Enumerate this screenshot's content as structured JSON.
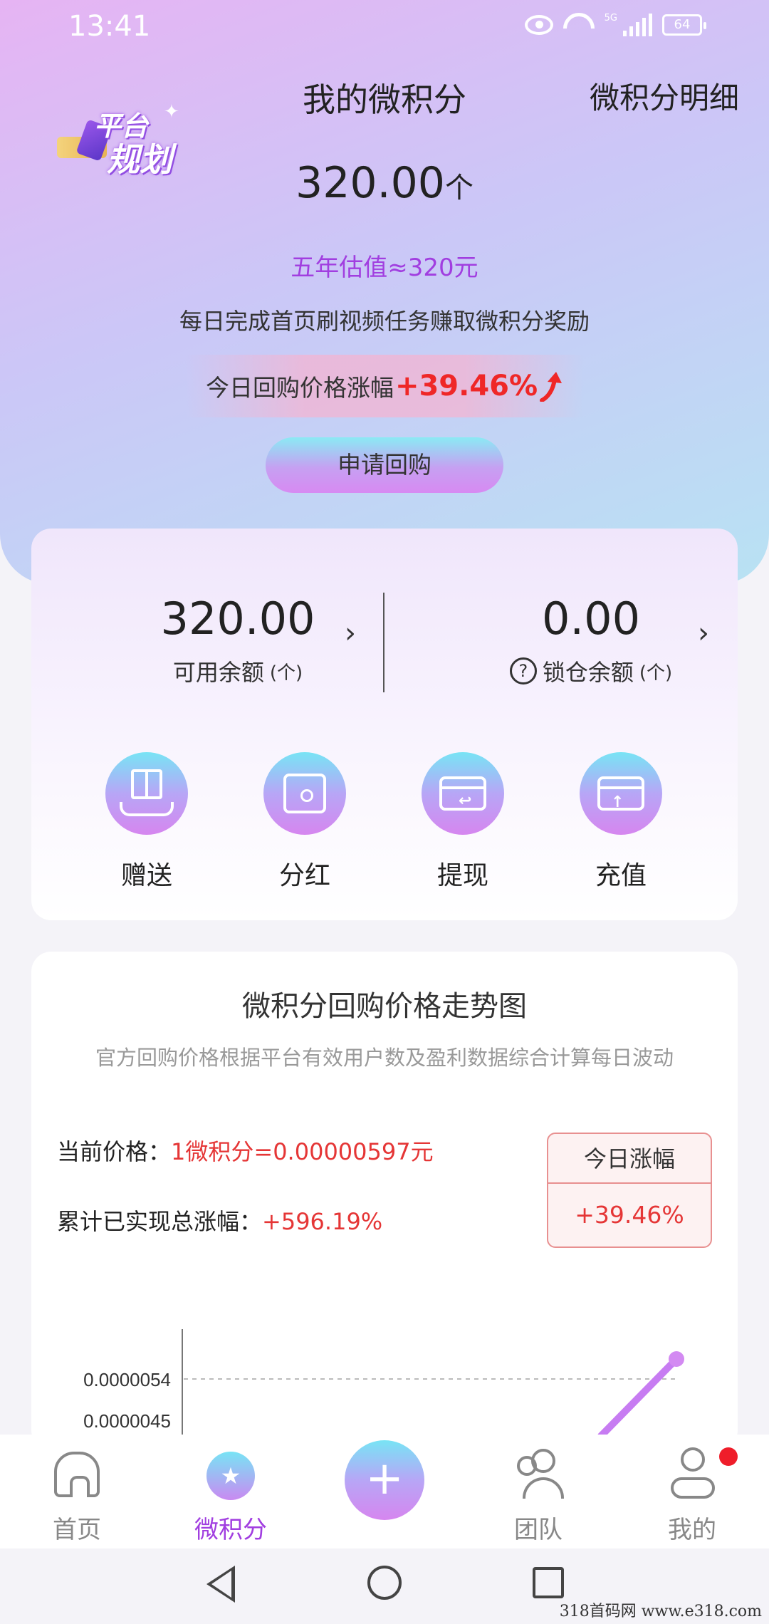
{
  "status": {
    "time": "13:41",
    "network": "5G",
    "battery": "64"
  },
  "header": {
    "logo_line1": "平台",
    "logo_line2": "规划",
    "title": "我的微积分",
    "detail_link": "微积分明细"
  },
  "hero": {
    "balance_value": "320.00",
    "balance_unit": "个",
    "estimate": "五年估值≈320元",
    "tip": "每日完成首页刷视频任务赚取微积分奖励",
    "rise_label": "今日回购价格涨幅",
    "rise_value": "+39.46%",
    "buyback_button": "申请回购"
  },
  "balances": {
    "available_value": "320.00",
    "available_label": "可用余额",
    "available_unit": "(个)",
    "locked_value": "0.00",
    "locked_label": "锁仓余额",
    "locked_unit": "(个)",
    "chevron": "›",
    "help_icon": "?"
  },
  "actions": [
    {
      "label": "赠送",
      "icon": "gift-hand-icon"
    },
    {
      "label": "分红",
      "icon": "box-icon"
    },
    {
      "label": "提现",
      "icon": "card-withdraw-icon"
    },
    {
      "label": "充值",
      "icon": "card-deposit-icon"
    }
  ],
  "trend": {
    "title": "微积分回购价格走势图",
    "subtitle": "官方回购价格根据平台有效用户数及盈利数据综合计算每日波动",
    "current_price_label": "当前价格：",
    "current_price_value": "1微积分=0.00000597元",
    "total_rise_label": "累计已实现总涨幅：",
    "total_rise_value": "+596.19%",
    "today_label": "今日涨幅",
    "today_value": "+39.46%"
  },
  "chart_data": {
    "type": "line",
    "y_tick_labels": [
      "0.0000054",
      "0.0000045"
    ],
    "series": [
      {
        "points": [
          [
            4.5e-06,
            4.5e-06
          ],
          [
            5.97e-06,
            5.97e-06
          ]
        ]
      }
    ],
    "grid": "dashed horizontal",
    "line_color": "#c77cf2"
  },
  "tabbar": {
    "tabs": [
      {
        "label": "首页",
        "icon": "home-icon"
      },
      {
        "label": "微积分",
        "icon": "star-circle-icon"
      },
      {
        "label": "",
        "icon": "plus-icon"
      },
      {
        "label": "团队",
        "icon": "team-icon"
      },
      {
        "label": "我的",
        "icon": "person-icon"
      }
    ],
    "plus_glyph": "+"
  },
  "watermark": "318首码网  www.e318.com",
  "colors": {
    "accent_purple": "#a13ee0",
    "red": "#e53636",
    "cyan": "#78e4f5",
    "pink_purple": "#d686ef"
  }
}
